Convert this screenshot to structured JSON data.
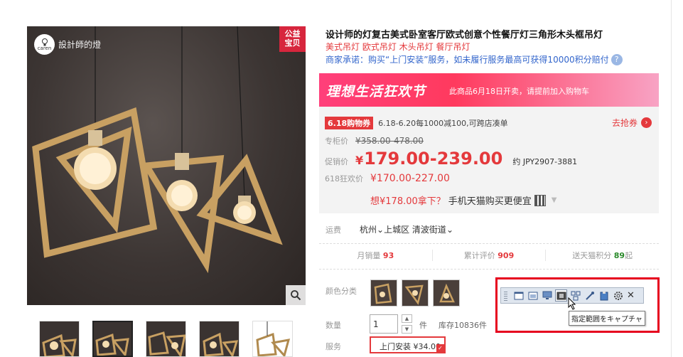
{
  "brand": {
    "logo_text": "caren",
    "name": "設計師的燈"
  },
  "image": {
    "badge_line1": "公益",
    "badge_line2": "宝贝",
    "zoom_icon": "magnifier-icon"
  },
  "product": {
    "title": "设计师的灯复古美式卧室客厅欧式创意个性餐厅灯三角形木头框吊灯",
    "subtitle": "美式吊灯 欧式吊灯 木头吊灯 餐厅吊灯",
    "promise": "商家承诺：购买“上门安装”服务，如未履行服务最高可获得10000积分赔付",
    "promise_icon": "?"
  },
  "banner": {
    "title": "理想生活狂欢节",
    "subtitle": "此商品6月18日开卖，请提前加入购物车"
  },
  "price": {
    "coupon_badge": "6.18购物券",
    "coupon_text": "6.18-6.20每1000减100,可跨店凑单",
    "coupon_link": "去抢券",
    "counter_label": "专柜价",
    "counter_value": "¥358.00-478.00",
    "promo_label": "促销价",
    "promo_yen": "¥",
    "promo_value": "179.00-239.00",
    "approx": "约 JPY2907-3881",
    "p618_label": "618狂欢价",
    "p618_value": "¥170.00-227.00",
    "phone_red": "想¥178.00拿下？",
    "phone_text": "手机天猫购买更便宜"
  },
  "delivery": {
    "label": "运费",
    "city": "杭州",
    "district": "上城区",
    "street": "清波街道"
  },
  "stats": [
    {
      "label": "月销量",
      "value": "93"
    },
    {
      "label": "累计评价",
      "value": "909"
    },
    {
      "label": "送天猫积分",
      "value": "89",
      "suffix": "起"
    }
  ],
  "sku": {
    "color_label": "颜色分类",
    "qty_label": "数量",
    "qty_value": "1",
    "qty_unit": "件",
    "stock": "库存10836件",
    "service_label": "服务",
    "service_value": "上门安装 ¥34.00",
    "service_check": "✓"
  },
  "snip_tool": {
    "tooltip": "指定範囲をキャプチャ",
    "close": "✕",
    "frame_color": "#e6001e"
  },
  "colors": {
    "accent": "#e4393c",
    "link": "#3366cc",
    "banner": "#ff3f7a"
  }
}
